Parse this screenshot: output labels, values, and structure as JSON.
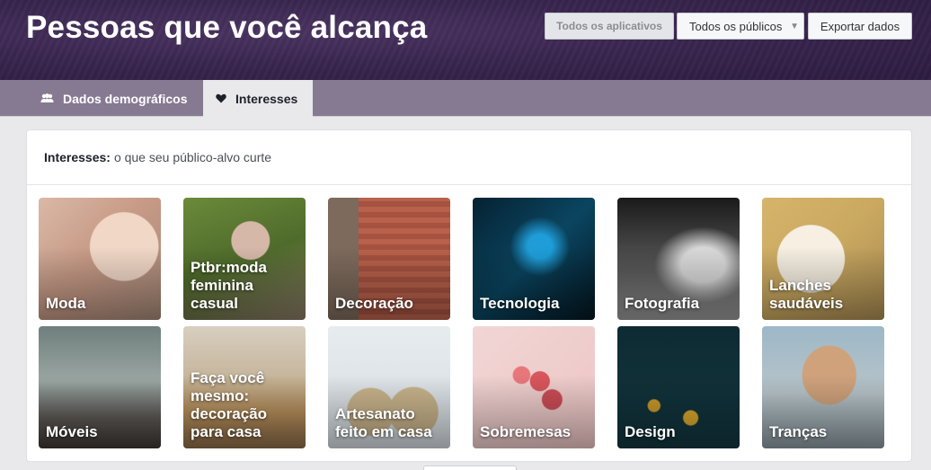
{
  "header": {
    "title": "Pessoas que você alcança",
    "buttons": {
      "apps": "Todos os aplicativos",
      "audience": "Todos os públicos",
      "export": "Exportar dados"
    }
  },
  "tabs": [
    {
      "label": "Dados demográficos",
      "icon": "people-icon"
    },
    {
      "label": "Interesses",
      "icon": "heart-icon",
      "active": true
    }
  ],
  "interests": {
    "heading_bold": "Interesses:",
    "heading_text": "o que seu público-alvo curte",
    "tiles": [
      {
        "label": "Moda"
      },
      {
        "label": "Ptbr:moda feminina casual"
      },
      {
        "label": "Decoração"
      },
      {
        "label": "Tecnologia"
      },
      {
        "label": "Fotografia"
      },
      {
        "label": "Lanches saudáveis"
      },
      {
        "label": "Móveis"
      },
      {
        "label": "Faça você mesmo: decoração para casa"
      },
      {
        "label": "Artesanato feito em casa"
      },
      {
        "label": "Sobremesas"
      },
      {
        "label": "Design"
      },
      {
        "label": "Tranças"
      }
    ]
  },
  "colors": {
    "header_bg": "#3a2650",
    "tabbar_bg": "#867a92",
    "page_bg": "#e9e9ec"
  }
}
